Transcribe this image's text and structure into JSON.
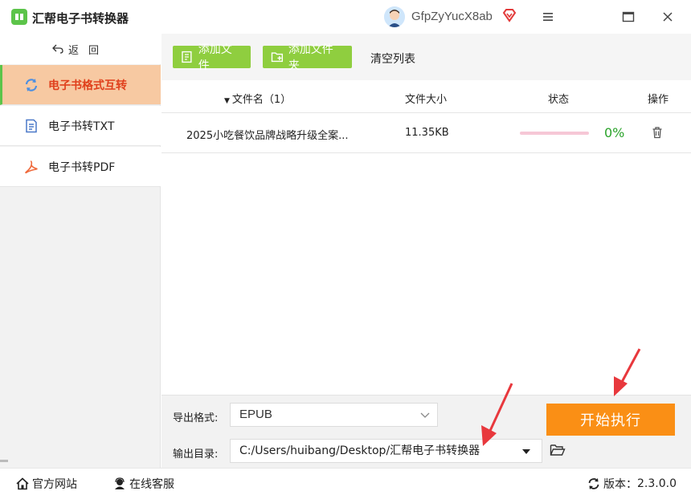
{
  "app": {
    "title": "汇帮电子书转换器",
    "username": "GfpZyYucX8ab"
  },
  "sidebar": {
    "back_label": "返回",
    "items": [
      {
        "label": "电子书格式互转",
        "icon": "sync-icon",
        "active": true
      },
      {
        "label": "电子书转TXT",
        "icon": "document-icon",
        "active": false
      },
      {
        "label": "电子书转PDF",
        "icon": "pdf-icon",
        "active": false
      }
    ]
  },
  "toolbar": {
    "add_file": "添加文件",
    "add_folder": "添加文件夹",
    "clear_list": "清空列表"
  },
  "table": {
    "headers": {
      "name": "文件名（1）",
      "size": "文件大小",
      "status": "状态",
      "action": "操作"
    },
    "rows": [
      {
        "name": "2025小吃餐饮品牌战略升级全案...",
        "size": "11.35KB",
        "percent": "0%",
        "progress": 0
      }
    ]
  },
  "settings": {
    "format_label": "导出格式:",
    "format_value": "EPUB",
    "dir_label": "输出目录:",
    "dir_value": "C:/Users/huibang/Desktop/汇帮电子书转换器",
    "start_label": "开始执行"
  },
  "footer": {
    "website": "官方网站",
    "support": "在线客服",
    "version_label": "版本：",
    "version": "2.3.0.0"
  },
  "colors": {
    "accent_green": "#8fce3f",
    "start_orange": "#fa8f15",
    "active_bg": "#f7c9a2",
    "active_text": "#e0401c",
    "percent_green": "#2aa32a",
    "arrow_red": "#e8383d"
  }
}
